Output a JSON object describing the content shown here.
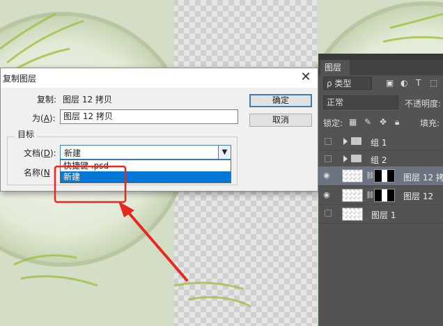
{
  "dialog": {
    "title": "复制图层",
    "copy_label": "复制:",
    "copy_value": "图层 12 拷贝",
    "as_label_pre": "为(",
    "as_label_key": "A",
    "as_label_post": "):",
    "as_value": "图层 12 拷贝",
    "ok_label": "确定",
    "cancel_label": "取消",
    "target_legend": "目标",
    "doc_label_pre": "文档(",
    "doc_label_key": "D",
    "doc_label_post": "):",
    "doc_selected": "新建",
    "name_label_pre": "名称(",
    "name_label_key": "N",
    "dropdown_options": [
      "快捷键 .psd",
      "新建"
    ],
    "close_glyph": "✕",
    "select_arrow_glyph": "▼"
  },
  "panel": {
    "tab_label": "图层",
    "filter_value": "ρ 类型",
    "blend_mode": "正常",
    "opacity_label": "不透明度:",
    "lock_label": "锁定:",
    "fill_label": "填充:",
    "layers": [
      {
        "name": "组 1",
        "type": "group",
        "visible": false,
        "active": false
      },
      {
        "name": "组 2",
        "type": "group",
        "visible": false,
        "active": false
      },
      {
        "name": "图层 12 拷",
        "type": "masked",
        "visible": true,
        "active": true
      },
      {
        "name": "图层 12",
        "type": "masked",
        "visible": true,
        "active": false
      },
      {
        "name": "图层 1",
        "type": "plain",
        "visible": false,
        "active": false
      }
    ]
  },
  "colors": {
    "highlight": "#0078d7",
    "annotation": "#e8281e",
    "panel": "#535353"
  }
}
